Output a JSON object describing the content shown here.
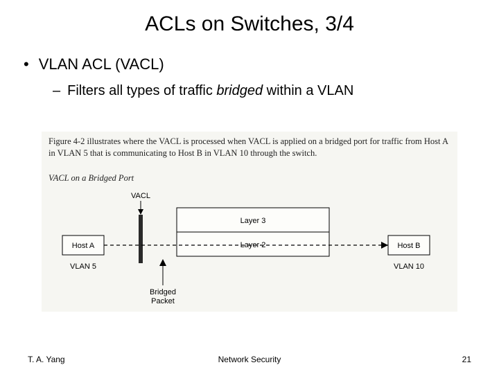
{
  "title": "ACLs on Switches, 3/4",
  "bullet_main": "VLAN ACL (VACL)",
  "bullet_sub_pre": "Filters all types of traffic ",
  "bullet_sub_em": "bridged",
  "bullet_sub_post": " within a VLAN",
  "figure": {
    "caption": "Figure 4-2 illustrates where the VACL is processed when VACL is applied on a bridged port for traffic from Host A in VLAN 5 that is communicating to Host B in VLAN 10 through the switch.",
    "subtitle": "VACL on a Bridged Port",
    "labels": {
      "vacl": "VACL",
      "layer3": "Layer 3",
      "layer2": "Layer 2",
      "hostA": "Host A",
      "hostB": "Host B",
      "vlan5": "VLAN 5",
      "vlan10": "VLAN 10",
      "bridged": "Bridged\nPacket"
    }
  },
  "footer": {
    "left": "T. A. Yang",
    "center": "Network Security",
    "right": "21"
  }
}
